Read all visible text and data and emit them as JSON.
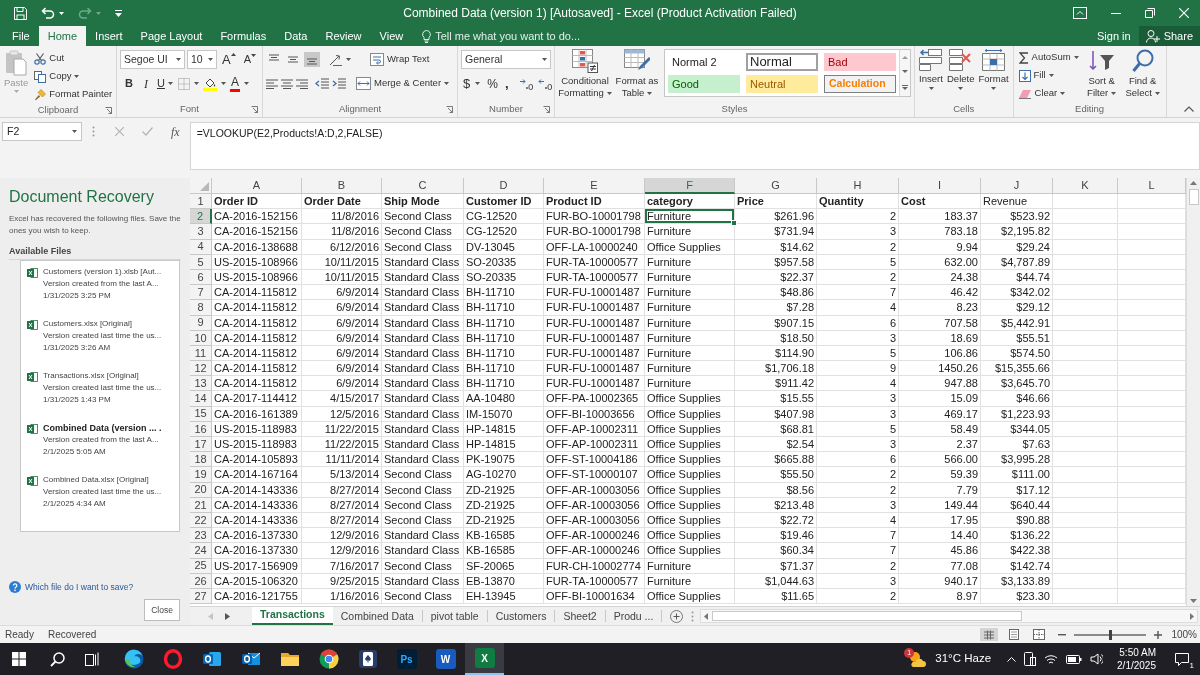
{
  "title_bar": {
    "quick_access": [
      {
        "kind": "save",
        "disabled": false
      },
      {
        "kind": "undo",
        "disabled": false
      },
      {
        "kind": "redo",
        "disabled": true
      },
      {
        "kind": "customize",
        "disabled": false
      }
    ],
    "title": "Combined Data (version 1) [Autosaved] - Excel (Product Activation Failed)"
  },
  "ribbon_tabs": [
    {
      "label": "File",
      "selected": false
    },
    {
      "label": "Home",
      "selected": true
    },
    {
      "label": "Insert",
      "selected": false
    },
    {
      "label": "Page Layout",
      "selected": false
    },
    {
      "label": "Formulas",
      "selected": false
    },
    {
      "label": "Data",
      "selected": false
    },
    {
      "label": "Review",
      "selected": false
    },
    {
      "label": "View",
      "selected": false
    }
  ],
  "tell_me": {
    "placeholder": "Tell me what you want to do..."
  },
  "account": {
    "sign_in": "Sign in",
    "share": "Share"
  },
  "ribbon": {
    "clipboard": {
      "label": "Clipboard",
      "paste": {
        "label": "Paste",
        "disabled": true
      },
      "cut": "Cut",
      "copy": "Copy",
      "format_painter": "Format Painter"
    },
    "font": {
      "label": "Font",
      "font_name": "Segoe UI",
      "font_size": "10",
      "grow": "A",
      "shrink": "A",
      "bold": "B",
      "italic": "I",
      "underline": "U",
      "font_color": "A"
    },
    "alignment": {
      "label": "Alignment",
      "vertical_align": [
        {
          "kind": "top",
          "selected": false
        },
        {
          "kind": "middle",
          "selected": false
        },
        {
          "kind": "bottom",
          "selected": true
        }
      ],
      "wrap_text": "Wrap Text",
      "merge_center": "Merge & Center"
    },
    "number": {
      "label": "Number",
      "format": "General",
      "currency": "$",
      "percent": "%",
      "comma": ","
    },
    "styles": {
      "label": "Styles",
      "conditional_formatting": "Conditional Formatting",
      "format_as_table": "Format as Table",
      "cell_styles": [
        {
          "name": "Normal 2",
          "kind": "normal2",
          "selected": false
        },
        {
          "name": "Normal",
          "kind": "normal",
          "selected": true
        },
        {
          "name": "Bad",
          "kind": "bad",
          "selected": false
        },
        {
          "name": "Good",
          "kind": "good",
          "selected": false
        },
        {
          "name": "Neutral",
          "kind": "neutral",
          "selected": false
        },
        {
          "name": "Calculation",
          "kind": "calculation",
          "selected": false
        }
      ]
    },
    "cells": {
      "label": "Cells",
      "buttons": [
        {
          "label": "Insert",
          "kind": "insert"
        },
        {
          "label": "Delete",
          "kind": "delete"
        },
        {
          "label": "Format",
          "kind": "format"
        }
      ]
    },
    "editing": {
      "label": "Editing",
      "autosum": "AutoSum",
      "fill": "Fill",
      "clear": "Clear",
      "sort_filter": "Sort & Filter",
      "find_select": "Find & Select"
    }
  },
  "formula_bar": {
    "name_box": "F2",
    "function_button": "fx",
    "formula": "=VLOOKUP(E2,Products!A:D,2,FALSE)"
  },
  "recovery_pane": {
    "title": "Document Recovery",
    "message": "Excel has recovered the following files. Save the ones you wish to keep.",
    "heading": "Available Files",
    "files": [
      {
        "name": "Customers (version 1).xlsb [Aut...",
        "detail": "Version created from the last A...",
        "time": "1/31/2025 3:25 PM",
        "selected": false
      },
      {
        "name": "Customers.xlsx [Original]",
        "detail": "Version created last time the us...",
        "time": "1/31/2025 3:26 AM",
        "selected": false
      },
      {
        "name": "Transactions.xlsx [Original]",
        "detail": "Version created last time the us...",
        "time": "1/31/2025 1:43 PM",
        "selected": false
      },
      {
        "name": "Combined Data (version ... .",
        "detail": "Version created from the last A...",
        "time": "2/1/2025 5:05 AM",
        "selected": true
      },
      {
        "name": "Combined Data.xlsx [Original]",
        "detail": "Version created last time the us...",
        "time": "2/1/2025 4:34 AM",
        "selected": false
      }
    ],
    "help_link": "Which file do I want to save?",
    "close_button": "Close"
  },
  "sheet": {
    "columns": [
      {
        "letter": "A",
        "kind": "text",
        "selected": false
      },
      {
        "letter": "B",
        "kind": "number",
        "selected": false
      },
      {
        "letter": "C",
        "kind": "text",
        "selected": false
      },
      {
        "letter": "D",
        "kind": "text",
        "selected": false
      },
      {
        "letter": "E",
        "kind": "text",
        "selected": false
      },
      {
        "letter": "F",
        "kind": "text",
        "selected": true
      },
      {
        "letter": "G",
        "kind": "number",
        "selected": false
      },
      {
        "letter": "H",
        "kind": "number",
        "selected": false
      },
      {
        "letter": "I",
        "kind": "number",
        "selected": false
      },
      {
        "letter": "J",
        "kind": "number",
        "selected": false
      },
      {
        "letter": "K",
        "selected": false
      },
      {
        "letter": "L",
        "selected": false
      }
    ],
    "header_row": {
      "number": "1",
      "selected": false,
      "cells": [
        {
          "text": "Order ID",
          "bold": true
        },
        {
          "text": "Order Date",
          "bold": true
        },
        {
          "text": "Ship Mode",
          "bold": true
        },
        {
          "text": "Customer ID",
          "bold": true
        },
        {
          "text": "Product ID",
          "bold": true
        },
        {
          "text": "category",
          "bold": true
        },
        {
          "text": "Price",
          "bold": true
        },
        {
          "text": "Quantity",
          "bold": true
        },
        {
          "text": "Cost",
          "bold": true
        },
        {
          "text": "Revenue",
          "bold": false
        }
      ]
    },
    "rows": [
      {
        "number": "2",
        "selected": true,
        "cells": [
          "CA-2016-152156",
          "11/8/2016",
          "Second Class",
          "CG-12520",
          "FUR-BO-10001798",
          "Furniture",
          "$261.96",
          "2",
          "183.37",
          "$523.92"
        ]
      },
      {
        "number": "3",
        "selected": false,
        "cells": [
          "CA-2016-152156",
          "11/8/2016",
          "Second Class",
          "CG-12520",
          "FUR-BO-10001798",
          "Furniture",
          "$731.94",
          "3",
          "783.18",
          "$2,195.82"
        ]
      },
      {
        "number": "4",
        "selected": false,
        "cells": [
          "CA-2016-138688",
          "6/12/2016",
          "Second Class",
          "DV-13045",
          "OFF-LA-10000240",
          "Office Supplies",
          "$14.62",
          "2",
          "9.94",
          "$29.24"
        ]
      },
      {
        "number": "5",
        "selected": false,
        "cells": [
          "US-2015-108966",
          "10/11/2015",
          "Standard Class",
          "SO-20335",
          "FUR-TA-10000577",
          "Furniture",
          "$957.58",
          "5",
          "632.00",
          "$4,787.89"
        ]
      },
      {
        "number": "6",
        "selected": false,
        "cells": [
          "US-2015-108966",
          "10/11/2015",
          "Standard Class",
          "SO-20335",
          "FUR-TA-10000577",
          "Furniture",
          "$22.37",
          "2",
          "24.38",
          "$44.74"
        ]
      },
      {
        "number": "7",
        "selected": false,
        "cells": [
          "CA-2014-115812",
          "6/9/2014",
          "Standard Class",
          "BH-11710",
          "FUR-FU-10001487",
          "Furniture",
          "$48.86",
          "7",
          "46.42",
          "$342.02"
        ]
      },
      {
        "number": "8",
        "selected": false,
        "cells": [
          "CA-2014-115812",
          "6/9/2014",
          "Standard Class",
          "BH-11710",
          "FUR-FU-10001487",
          "Furniture",
          "$7.28",
          "4",
          "8.23",
          "$29.12"
        ]
      },
      {
        "number": "9",
        "selected": false,
        "cells": [
          "CA-2014-115812",
          "6/9/2014",
          "Standard Class",
          "BH-11710",
          "FUR-FU-10001487",
          "Furniture",
          "$907.15",
          "6",
          "707.58",
          "$5,442.91"
        ]
      },
      {
        "number": "10",
        "selected": false,
        "cells": [
          "CA-2014-115812",
          "6/9/2014",
          "Standard Class",
          "BH-11710",
          "FUR-FU-10001487",
          "Furniture",
          "$18.50",
          "3",
          "18.69",
          "$55.51"
        ]
      },
      {
        "number": "11",
        "selected": false,
        "cells": [
          "CA-2014-115812",
          "6/9/2014",
          "Standard Class",
          "BH-11710",
          "FUR-FU-10001487",
          "Furniture",
          "$114.90",
          "5",
          "106.86",
          "$574.50"
        ]
      },
      {
        "number": "12",
        "selected": false,
        "cells": [
          "CA-2014-115812",
          "6/9/2014",
          "Standard Class",
          "BH-11710",
          "FUR-FU-10001487",
          "Furniture",
          "$1,706.18",
          "9",
          "1450.26",
          "$15,355.66"
        ]
      },
      {
        "number": "13",
        "selected": false,
        "cells": [
          "CA-2014-115812",
          "6/9/2014",
          "Standard Class",
          "BH-11710",
          "FUR-FU-10001487",
          "Furniture",
          "$911.42",
          "4",
          "947.88",
          "$3,645.70"
        ]
      },
      {
        "number": "14",
        "selected": false,
        "cells": [
          "CA-2017-114412",
          "4/15/2017",
          "Standard Class",
          "AA-10480",
          "OFF-PA-10002365",
          "Office Supplies",
          "$15.55",
          "3",
          "15.09",
          "$46.66"
        ]
      },
      {
        "number": "15",
        "selected": false,
        "cells": [
          "CA-2016-161389",
          "12/5/2016",
          "Standard Class",
          "IM-15070",
          "OFF-BI-10003656",
          "Office Supplies",
          "$407.98",
          "3",
          "469.17",
          "$1,223.93"
        ]
      },
      {
        "number": "16",
        "selected": false,
        "cells": [
          "US-2015-118983",
          "11/22/2015",
          "Standard Class",
          "HP-14815",
          "OFF-AP-10002311",
          "Office Supplies",
          "$68.81",
          "5",
          "58.49",
          "$344.05"
        ]
      },
      {
        "number": "17",
        "selected": false,
        "cells": [
          "US-2015-118983",
          "11/22/2015",
          "Standard Class",
          "HP-14815",
          "OFF-AP-10002311",
          "Office Supplies",
          "$2.54",
          "3",
          "2.37",
          "$7.63"
        ]
      },
      {
        "number": "18",
        "selected": false,
        "cells": [
          "CA-2014-105893",
          "11/11/2014",
          "Standard Class",
          "PK-19075",
          "OFF-ST-10004186",
          "Office Supplies",
          "$665.88",
          "6",
          "566.00",
          "$3,995.28"
        ]
      },
      {
        "number": "19",
        "selected": false,
        "cells": [
          "CA-2014-167164",
          "5/13/2014",
          "Second Class",
          "AG-10270",
          "OFF-ST-10000107",
          "Office Supplies",
          "$55.50",
          "2",
          "59.39",
          "$111.00"
        ]
      },
      {
        "number": "20",
        "selected": false,
        "cells": [
          "CA-2014-143336",
          "8/27/2014",
          "Second Class",
          "ZD-21925",
          "OFF-AR-10003056",
          "Office Supplies",
          "$8.56",
          "2",
          "7.79",
          "$17.12"
        ]
      },
      {
        "number": "21",
        "selected": false,
        "cells": [
          "CA-2014-143336",
          "8/27/2014",
          "Second Class",
          "ZD-21925",
          "OFF-AR-10003056",
          "Office Supplies",
          "$213.48",
          "3",
          "149.44",
          "$640.44"
        ]
      },
      {
        "number": "22",
        "selected": false,
        "cells": [
          "CA-2014-143336",
          "8/27/2014",
          "Second Class",
          "ZD-21925",
          "OFF-AR-10003056",
          "Office Supplies",
          "$22.72",
          "4",
          "17.95",
          "$90.88"
        ]
      },
      {
        "number": "23",
        "selected": false,
        "cells": [
          "CA-2016-137330",
          "12/9/2016",
          "Standard Class",
          "KB-16585",
          "OFF-AR-10000246",
          "Office Supplies",
          "$19.46",
          "7",
          "14.40",
          "$136.22"
        ]
      },
      {
        "number": "24",
        "selected": false,
        "cells": [
          "CA-2016-137330",
          "12/9/2016",
          "Standard Class",
          "KB-16585",
          "OFF-AR-10000246",
          "Office Supplies",
          "$60.34",
          "7",
          "45.86",
          "$422.38"
        ]
      },
      {
        "number": "25",
        "selected": false,
        "cells": [
          "US-2017-156909",
          "7/16/2017",
          "Second Class",
          "SF-20065",
          "FUR-CH-10002774",
          "Furniture",
          "$71.37",
          "2",
          "77.08",
          "$142.74"
        ]
      },
      {
        "number": "26",
        "selected": false,
        "cells": [
          "CA-2015-106320",
          "9/25/2015",
          "Standard Class",
          "EB-13870",
          "FUR-TA-10000577",
          "Furniture",
          "$1,044.63",
          "3",
          "940.17",
          "$3,133.89"
        ]
      },
      {
        "number": "27",
        "selected": false,
        "cells": [
          "CA-2016-121755",
          "1/16/2016",
          "Second Class",
          "EH-13945",
          "OFF-BI-10001634",
          "Office Supplies",
          "$11.65",
          "2",
          "8.97",
          "$23.30"
        ]
      }
    ]
  },
  "sheet_tabs": [
    {
      "label": "Transactions",
      "selected": true
    },
    {
      "label": "Combined Data",
      "selected": false
    },
    {
      "label": "pivot table",
      "selected": false
    },
    {
      "label": "Customers",
      "selected": false
    },
    {
      "label": "Sheet2",
      "selected": false
    },
    {
      "label": "Produ ...",
      "selected": false
    }
  ],
  "status_bar": {
    "mode": "Ready",
    "state": "Recovered",
    "views": [
      {
        "kind": "normal",
        "selected": true
      },
      {
        "kind": "page_layout",
        "selected": false
      },
      {
        "kind": "page_break",
        "selected": false
      }
    ],
    "zoom": {
      "level": 0.5,
      "label": "100%"
    }
  },
  "taskbar": {
    "apps": [
      {
        "kind": "edge",
        "selected": false
      },
      {
        "kind": "opera",
        "selected": false
      },
      {
        "kind": "outlook_new",
        "selected": false
      },
      {
        "kind": "outlook",
        "selected": false
      },
      {
        "kind": "explorer",
        "selected": false
      },
      {
        "kind": "chrome",
        "selected": false
      },
      {
        "kind": "solitaire",
        "selected": false
      },
      {
        "kind": "photoshop",
        "label": "Ps",
        "selected": false
      },
      {
        "kind": "word",
        "label": "W",
        "selected": false
      },
      {
        "kind": "excel",
        "label": "X",
        "selected": true
      }
    ],
    "weather": {
      "badge": "1",
      "text": "31°C Haze"
    },
    "clock": {
      "time": "5:50 AM",
      "date": "2/1/2025"
    },
    "notification_count": "1"
  }
}
